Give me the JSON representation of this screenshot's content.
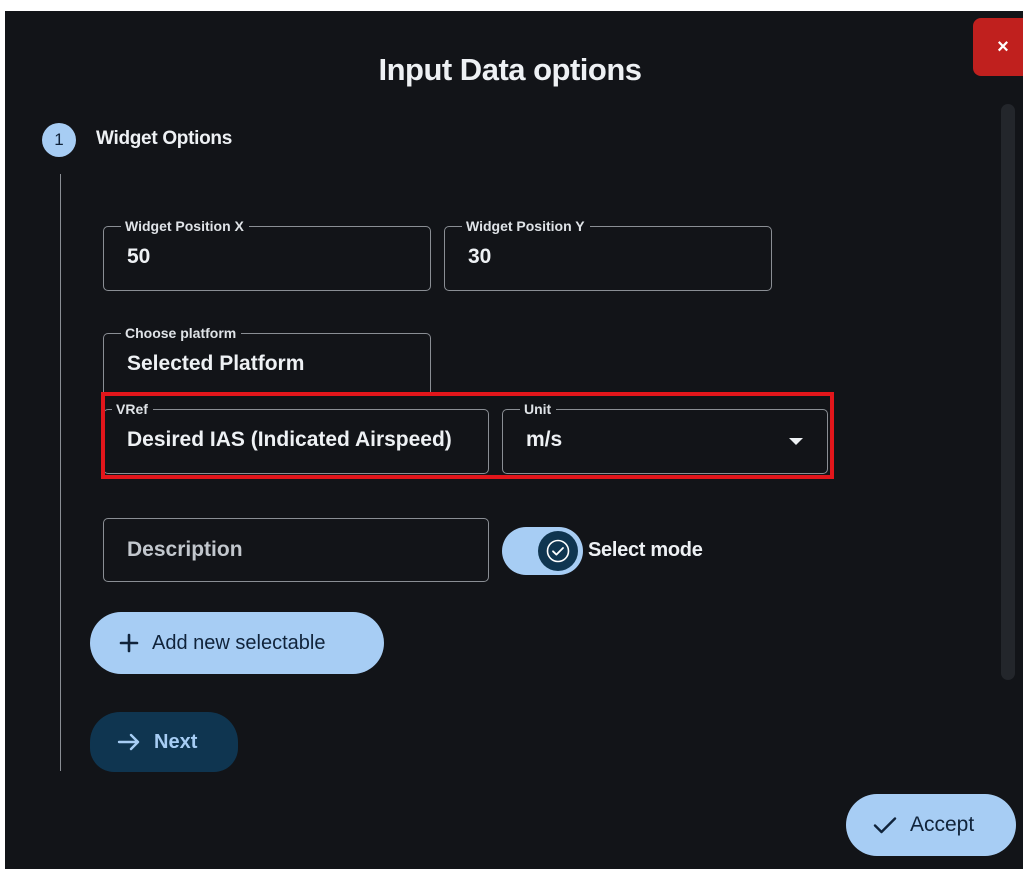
{
  "dialog": {
    "title": "Input Data options",
    "close_label": "×"
  },
  "step": {
    "number": "1",
    "title": "Widget Options"
  },
  "fields": {
    "pos_x": {
      "label": "Widget Position X",
      "value": "50"
    },
    "pos_y": {
      "label": "Widget Position Y",
      "value": "30"
    },
    "platform": {
      "label": "Choose platform",
      "value": "Selected Platform"
    },
    "vref": {
      "label": "VRef",
      "value": "Desired IAS (Indicated Airspeed)"
    },
    "unit": {
      "label": "Unit",
      "value": "m/s"
    },
    "description": {
      "placeholder": "Description"
    }
  },
  "toggle": {
    "label": "Select mode",
    "checked": true
  },
  "buttons": {
    "add_label": "Add new selectable",
    "next_label": "Next",
    "accept_label": "Accept"
  },
  "icons": {
    "close": "close-icon",
    "add": "plus-icon",
    "next": "arrow-right-icon",
    "accept": "check-icon",
    "toggle": "check-icon",
    "unit_dropdown": "caret-down-icon"
  },
  "colors": {
    "background": "#121418",
    "accent": "#a7cdf4",
    "accent_dark": "#0f3550",
    "close": "#c0201e",
    "highlight": "#e2161b"
  }
}
